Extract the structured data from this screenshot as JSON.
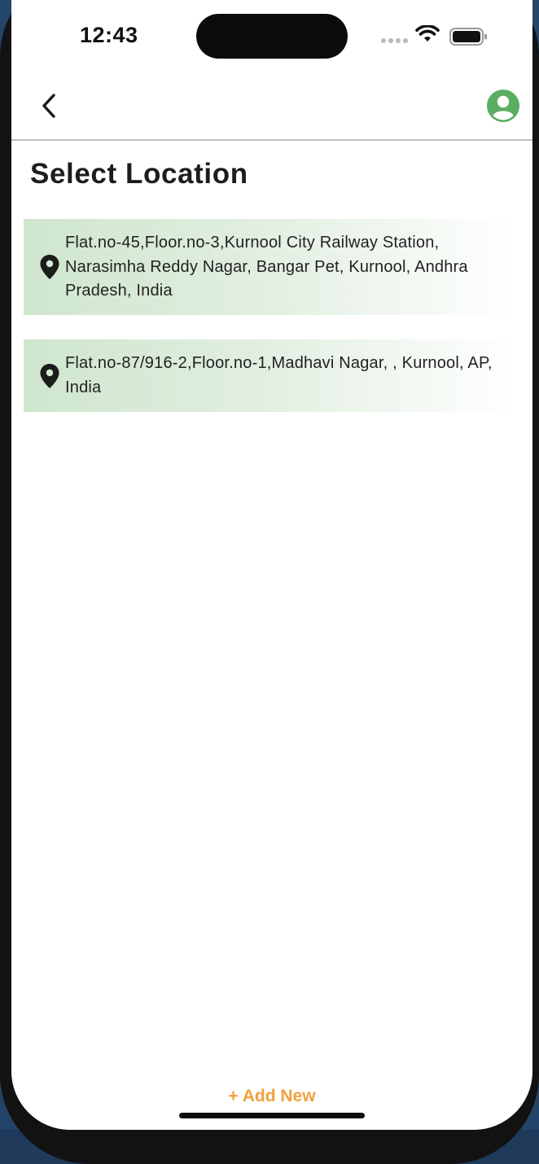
{
  "status_bar": {
    "time": "12:43"
  },
  "header": {
    "back_icon": "chevron-left-icon",
    "avatar_icon": "user-avatar-icon",
    "avatar_color": "#5aae60"
  },
  "page": {
    "title": "Select Location"
  },
  "locations": [
    {
      "icon": "location-pin-icon",
      "address": "Flat.no-45,Floor.no-3,Kurnool City Railway Station, Narasimha Reddy Nagar, Bangar Pet, Kurnool, Andhra Pradesh, India"
    },
    {
      "icon": "location-pin-icon",
      "address": "Flat.no-87/916-2,Floor.no-1,Madhavi Nagar, , Kurnool, AP, India"
    }
  ],
  "footer": {
    "add_new_label": "+ Add New",
    "accent_color": "#f0a03c"
  },
  "colors": {
    "card_gradient_start": "#cfe6cd",
    "title_text": "#1d1d1d"
  }
}
